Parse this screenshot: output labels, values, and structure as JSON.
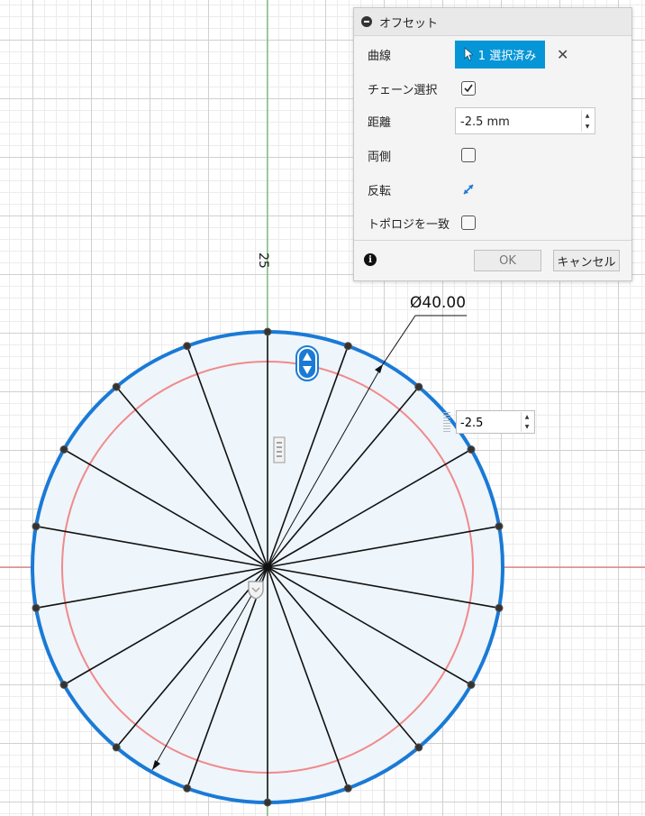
{
  "dialog": {
    "title": "オフセット",
    "rows": {
      "curve": {
        "label": "曲線",
        "selection": "1 選択済み"
      },
      "chain": {
        "label": "チェーン選択",
        "checked": true
      },
      "distance": {
        "label": "距離",
        "value": "-2.5 mm"
      },
      "both_sides": {
        "label": "両側",
        "checked": false
      },
      "flip": {
        "label": "反転"
      },
      "topology": {
        "label": "トポロジを一致",
        "checked": false
      }
    },
    "ok_label": "OK",
    "cancel_label": "キャンセル"
  },
  "canvas": {
    "dimension_label": "Ø40.00",
    "axis_label": "25",
    "inline_value": "-2.5"
  },
  "colors": {
    "selected_curve": "#1a7ad6",
    "offset_curve": "#f08a8a",
    "fill": "#eef5fb",
    "x_axis": "#e05a5a",
    "y_axis": "#4caf50",
    "accent": "#0696d7"
  }
}
